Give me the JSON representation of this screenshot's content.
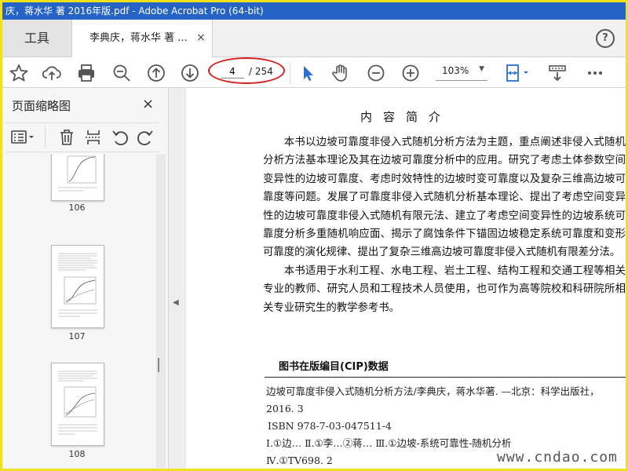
{
  "window": {
    "title": "庆，蒋水华 著 2016年版.pdf - Adobe Acrobat Pro (64-bit)"
  },
  "tabs": {
    "tools": "工具",
    "document": "李典庆，蒋水华 著 ...",
    "close_glyph": "×",
    "help_glyph": "?"
  },
  "toolbar": {
    "page_current": "4",
    "page_total": "/ 254",
    "zoom": "103%",
    "icons": [
      "bookmark-star-icon",
      "upload-cloud-icon",
      "print-icon",
      "zoom-out-magnifier-icon",
      "page-up-icon",
      "page-down-icon",
      "select-cursor-icon",
      "hand-icon",
      "zoom-minus-icon",
      "zoom-plus-icon",
      "fit-page-icon",
      "scroll-mode-icon",
      "more-icon"
    ],
    "highlight_color": "#d42020"
  },
  "sidebar": {
    "title": "页面缩略图",
    "close_glyph": "×",
    "thumbnails": [
      {
        "label": "106"
      },
      {
        "label": "107"
      },
      {
        "label": "108"
      }
    ]
  },
  "document": {
    "heading": "内容简介",
    "paragraphs": [
      "本书以边坡可靠度非侵入式随机分析方法为主题，重点阐述非侵入式随机分析方法基本理论及其在边坡可靠度分析中的应用。研究了考虑土体参数空间变异性的边坡可靠度、考虑时效特性的边坡时变可靠度以及复杂三维高边坡可靠度等问题。发展了可靠度非侵入式随机分析基本理论、提出了考虑空间变异性的边坡可靠度非侵入式随机有限元法、建立了考虑空间变异性的边坡系统可靠度分析多重随机响应面、揭示了腐蚀条件下锚固边坡稳定系统可靠度和变形可靠度的演化规律、提出了复杂三维高边坡可靠度非侵入式随机有限差分法。",
      "本书适用于水利工程、水电工程、岩土工程、结构工程和交通工程等相关专业的教师、研究人员和工程技术人员使用，也可作为高等院校和科研院所相关专业研究生的教学参考书。"
    ],
    "cip_title": "图书在版编目(CIP)数据",
    "cip_lines": [
      "边坡可靠度非侵入式随机分析方法/李典庆，蒋水华著. —北京：科学出版社，2016. 3",
      "ISBN 978-7-03-047511-4",
      "Ⅰ.①边…  Ⅱ.①李…②蒋…  Ⅲ.①边坡-系统可靠性-随机分析",
      "Ⅳ.①TV698. 2"
    ],
    "watermark": "www.cndao.com"
  },
  "colors": {
    "titlebar": "#2563c7",
    "frame": "#f0e11a",
    "accent_blue": "#2a6fd6"
  }
}
